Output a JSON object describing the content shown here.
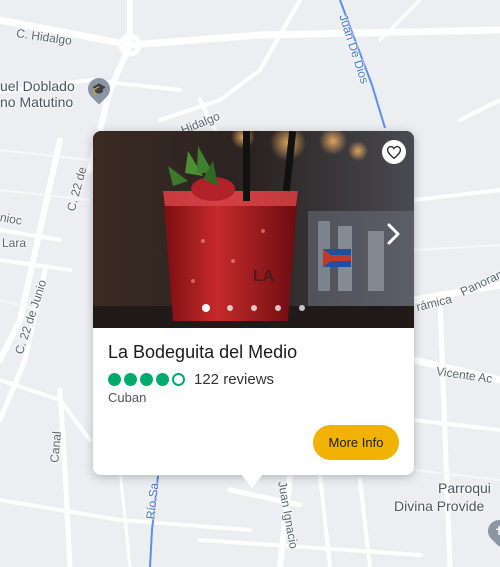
{
  "map": {
    "road_labels": {
      "hidalgo_top": "C. Hidalgo",
      "hidalgo_right": "Hidalgo",
      "juan_de_dios": "Juan De Dios",
      "c22_de_a": "C. 22 de",
      "c22_junio": "C. 22 de Junio",
      "nioc": "nioc",
      "lara": "Lara",
      "panoramica": "Panoramica",
      "ramica": "rámica",
      "vicente": "Vicente Ac",
      "canal": "Canal",
      "juan_ignacio": "Juan Ignacio",
      "rio_sa": "Río Sa"
    },
    "poi": {
      "school_line1": "uel Doblado",
      "school_line2": "no Matutino",
      "church_line1": "Parroqui",
      "church_line2": "Divina Provide"
    },
    "colors": {
      "background": "#eceef1",
      "road": "#ffffff",
      "water": "#5b8fe8"
    }
  },
  "card": {
    "title": "La Bodeguita del Medio",
    "rating_bubbles": 4,
    "rating_max": 5,
    "reviews_text": "122 reviews",
    "cuisine": "Cuban",
    "button_label": "More Info",
    "photo_dots": 5,
    "active_dot": 0,
    "colors": {
      "accent": "#f2b203",
      "rating": "#00aa6c"
    },
    "icons": {
      "favorite": "heart-icon",
      "next": "chevron-right-icon"
    }
  }
}
